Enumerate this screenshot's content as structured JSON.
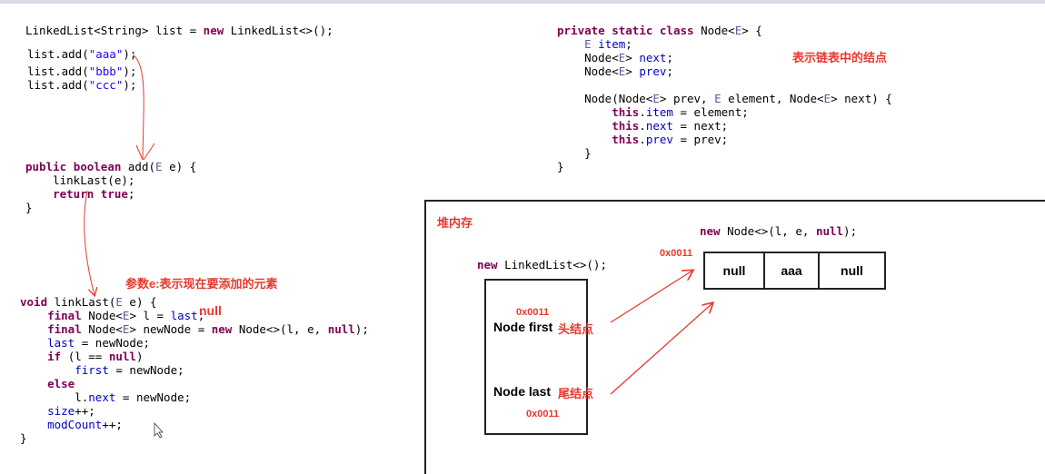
{
  "code_top_left": {
    "line1": [
      "LinkedList<String> list = ",
      "new",
      " LinkedList<>();"
    ],
    "adds": [
      [
        "list.add(",
        "\"aaa\"",
        ");"
      ],
      [
        "list.add(",
        "\"bbb\"",
        ");"
      ],
      [
        "list.add(",
        "\"ccc\"",
        ");"
      ]
    ]
  },
  "code_add": {
    "l1": [
      "public",
      " ",
      "boolean",
      " add(",
      "E",
      " e) {"
    ],
    "l2": "    linkLast(e);",
    "l3": [
      "    ",
      "return",
      " ",
      "true",
      ";"
    ],
    "l4": "}"
  },
  "code_linklast": {
    "l1": [
      "void",
      " linkLast(",
      "E",
      " e) {"
    ],
    "l2": [
      "    ",
      "final",
      " Node<",
      "E",
      "> l = ",
      "last",
      ";"
    ],
    "l3": [
      "    ",
      "final",
      " Node<",
      "E",
      "> newNode = ",
      "new",
      " Node<>(l, e, ",
      "null",
      ");"
    ],
    "l4": [
      "    ",
      "last",
      " = newNode;"
    ],
    "l5": [
      "    ",
      "if",
      " (l == ",
      "null",
      ")"
    ],
    "l6": [
      "        ",
      "first",
      " = newNode;"
    ],
    "l7": [
      "    ",
      "else"
    ],
    "l8": [
      "        l.",
      "next",
      " = newNode;"
    ],
    "l9": [
      "    ",
      "size",
      "++;"
    ],
    "l10": [
      "    ",
      "modCount",
      "++;"
    ],
    "l11": "}"
  },
  "code_node": {
    "l1": [
      "private",
      " ",
      "static",
      " ",
      "class",
      " Node<",
      "E",
      "> {"
    ],
    "l2": [
      "    ",
      "E",
      " ",
      "item",
      ";"
    ],
    "l3": [
      "    Node<",
      "E",
      "> ",
      "next",
      ";"
    ],
    "l4": [
      "    Node<",
      "E",
      "> ",
      "prev",
      ";"
    ],
    "l5": [
      "    Node(Node<",
      "E",
      "> prev, ",
      "E",
      " element, Node<",
      "E",
      "> next) {"
    ],
    "l6": [
      "        ",
      "this",
      ".",
      "item",
      " = element;"
    ],
    "l7": [
      "        ",
      "this",
      ".",
      "next",
      " = next;"
    ],
    "l8": [
      "        ",
      "this",
      ".",
      "prev",
      " = prev;"
    ],
    "l9": "    }",
    "l10": "}"
  },
  "annotations": {
    "node_comment": "表示链表中的结点",
    "heap_title": "堆内存",
    "param_note": "参数e:表示现在要添加的元素",
    "null_note": "null",
    "head_note": "头结点",
    "tail_note": "尾结点"
  },
  "heap": {
    "new_node_expr": [
      "new",
      " Node<>(l, e, ",
      "null",
      ");"
    ],
    "new_linkedlist_expr": [
      "new",
      " LinkedList<>();"
    ],
    "addr_node": "0x0011",
    "addr_first": "0x0011",
    "addr_last": "0x0011",
    "first_label": "Node first",
    "last_label": "Node last",
    "cells": [
      "null",
      "aaa",
      "null"
    ]
  },
  "colors": {
    "keyword": "#7f0055",
    "field": "#0000c0",
    "string": "#2a00ff",
    "annotation_red": "#e8382e"
  }
}
